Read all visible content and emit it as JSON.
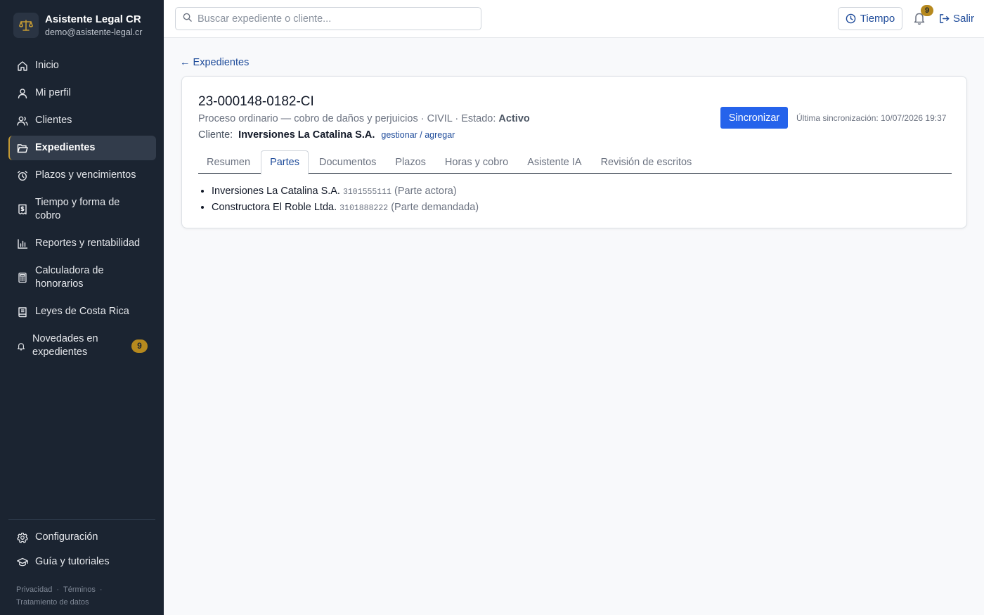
{
  "app": {
    "name": "Asistente Legal CR",
    "email": "demo@asistente-legal.cr",
    "logo_icon": "scale-icon"
  },
  "sidebar": {
    "items": [
      {
        "label": "Inicio",
        "icon": "home-icon"
      },
      {
        "label": "Mi perfil",
        "icon": "user-icon"
      },
      {
        "label": "Clientes",
        "icon": "users-icon"
      },
      {
        "label": "Expedientes",
        "icon": "folder-open-icon",
        "active": true
      },
      {
        "label": "Plazos y vencimientos",
        "icon": "alarm-clock-icon"
      },
      {
        "label": "Tiempo y forma de cobro",
        "icon": "receipt-dollar-icon"
      },
      {
        "label": "Reportes y rentabilidad",
        "icon": "bar-chart-icon"
      },
      {
        "label": "Calculadora de honorarios",
        "icon": "calculator-icon"
      },
      {
        "label": "Leyes de Costa Rica",
        "icon": "book-icon"
      },
      {
        "label": "Novedades en expedientes",
        "icon": "bell-icon",
        "badge": "9"
      }
    ],
    "bottom": [
      {
        "label": "Configuración",
        "icon": "gear-icon"
      },
      {
        "label": "Guía y tutoriales",
        "icon": "graduation-cap-icon"
      }
    ],
    "legal": {
      "privacy": "Privacidad",
      "terms": "Términos",
      "data": "Tratamiento de datos",
      "separator": "·"
    }
  },
  "topbar": {
    "search_placeholder": "Buscar expediente o cliente...",
    "tiempo_label": "Tiempo",
    "notifications_count": "9",
    "logout_label": "Salir"
  },
  "breadcrumb": {
    "back_label": "← Expedientes"
  },
  "case": {
    "number": "23-000148-0182-CI",
    "description": "Proceso ordinario — cobro de daños y perjuicios · CIVIL · Estado: ",
    "status": "Activo",
    "client_label": "Cliente:",
    "client_name": "Inversiones La Catalina S.A.",
    "client_manage": "gestionar / agregar",
    "sync_button": "Sincronizar",
    "last_sync": "Última sincronización: 10/07/2026 19:37"
  },
  "tabs": [
    {
      "label": "Resumen"
    },
    {
      "label": "Partes",
      "active": true
    },
    {
      "label": "Documentos"
    },
    {
      "label": "Plazos"
    },
    {
      "label": "Horas y cobro"
    },
    {
      "label": "Asistente IA"
    },
    {
      "label": "Revisión de escritos"
    }
  ],
  "parties": [
    {
      "name": "Inversiones La Catalina S.A.",
      "id": "3101555111",
      "role": "(Parte actora)"
    },
    {
      "name": "Constructora El Roble Ltda.",
      "id": "3101888222",
      "role": "(Parte demandada)"
    }
  ],
  "colors": {
    "sidebar_bg": "#1b2431",
    "accent_gold": "#b6891e",
    "primary_blue": "#2563eb",
    "link_blue": "#1e4b9a"
  }
}
